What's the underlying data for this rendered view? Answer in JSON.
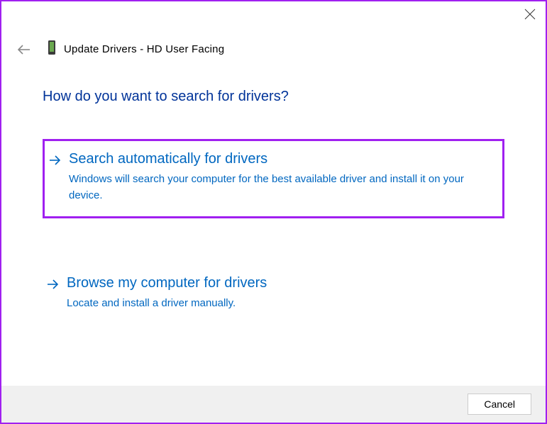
{
  "header": {
    "title": "Update Drivers - HD User Facing"
  },
  "main": {
    "prompt": "How do you want to search for drivers?",
    "options": [
      {
        "title": "Search automatically for drivers",
        "description": "Windows will search your computer for the best available driver and install it on your device."
      },
      {
        "title": "Browse my computer for drivers",
        "description": "Locate and install a driver manually."
      }
    ]
  },
  "footer": {
    "cancel_label": "Cancel"
  }
}
